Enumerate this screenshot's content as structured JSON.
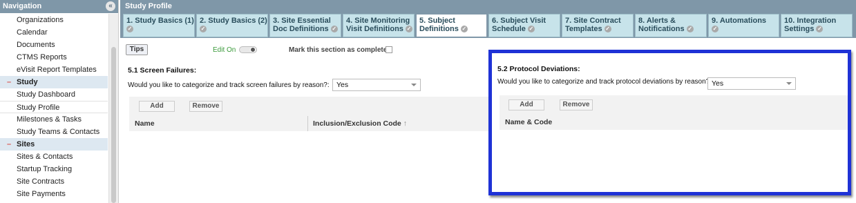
{
  "sidebar": {
    "title": "Navigation",
    "collapse_icon": "«",
    "items": [
      {
        "label": "Organizations",
        "kind": "item"
      },
      {
        "label": "Calendar",
        "kind": "item"
      },
      {
        "label": "Documents",
        "kind": "item"
      },
      {
        "label": "CTMS Reports",
        "kind": "item"
      },
      {
        "label": "eVisit Report Templates",
        "kind": "item"
      },
      {
        "label": "Study",
        "kind": "section"
      },
      {
        "label": "Study Dashboard",
        "kind": "item"
      },
      {
        "label": "Study Profile",
        "kind": "active"
      },
      {
        "label": "Milestones & Tasks",
        "kind": "item"
      },
      {
        "label": "Study Teams & Contacts",
        "kind": "item"
      },
      {
        "label": "Sites",
        "kind": "section"
      },
      {
        "label": "Sites & Contacts",
        "kind": "item"
      },
      {
        "label": "Startup Tracking",
        "kind": "item"
      },
      {
        "label": "Site Contracts",
        "kind": "item"
      },
      {
        "label": "Site Payments",
        "kind": "item"
      }
    ],
    "section_marker": "–"
  },
  "main": {
    "title": "Study Profile",
    "tabs": [
      {
        "line1": "1. Study Basics (1)",
        "line2": ""
      },
      {
        "line1": "2. Study Basics (2)",
        "line2": ""
      },
      {
        "line1": "3. Site Essential",
        "line2": "Doc Definitions"
      },
      {
        "line1": "4. Site Monitoring",
        "line2": "Visit Definitions"
      },
      {
        "line1": "5. Subject",
        "line2": "Definitions"
      },
      {
        "line1": "6. Subject Visit",
        "line2": "Schedule"
      },
      {
        "line1": "7. Site Contract",
        "line2": "Templates"
      },
      {
        "line1": "8. Alerts &",
        "line2": "Notifications"
      },
      {
        "line1": "9. Automations",
        "line2": ""
      },
      {
        "line1": "10. Integration",
        "line2": "Settings"
      }
    ],
    "tips_label": "Tips",
    "edit_on_label": "Edit On",
    "mark_complete_label": "Mark this section as complete:",
    "screen_failures": {
      "title": "5.1 Screen Failures:",
      "question": "Would you like to categorize and track screen failures by reason?:",
      "answer": "Yes",
      "add_label": "Add",
      "remove_label": "Remove",
      "col_name": "Name",
      "col_code": "Inclusion/Exclusion Code",
      "sort_icon": "↑"
    },
    "protocol_deviations": {
      "title": "5.2 Protocol Deviations:",
      "question": "Would you like to categorize and track protocol deviations by reason?:",
      "answer": "Yes",
      "add_label": "Add",
      "remove_label": "Remove",
      "col_name": "Name & Code"
    }
  },
  "colors": {
    "header": "#7f97a8",
    "tab": "#c7e3ea",
    "highlight": "#1f32d6",
    "edit_on": "#3a9a3a"
  }
}
